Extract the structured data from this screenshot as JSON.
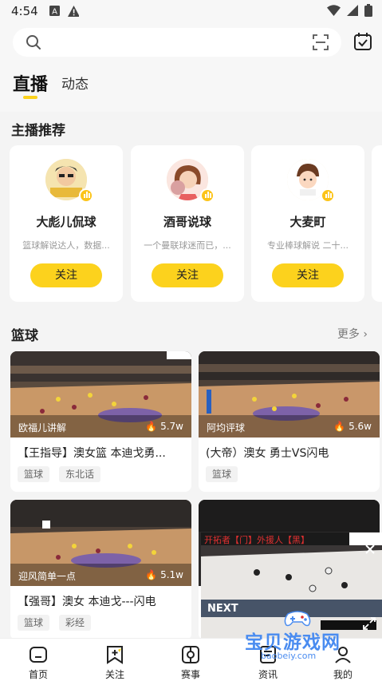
{
  "status": {
    "time": "4:54"
  },
  "search": {
    "placeholder": ""
  },
  "tabs": {
    "live": "直播",
    "feed": "动态"
  },
  "streamers_section": {
    "title": "主播推荐"
  },
  "streamers": [
    {
      "name": "大彪儿侃球",
      "desc": "篮球解说达人，数据...",
      "follow": "关注"
    },
    {
      "name": "酒哥说球",
      "desc": "一个曼联球迷而已，...",
      "follow": "关注"
    },
    {
      "name": "大麦町",
      "desc": "专业棒球解说 二十...",
      "follow": "关注"
    }
  ],
  "basketball": {
    "title": "篮球",
    "more": "更多"
  },
  "videos": [
    {
      "author": "欧福儿讲解",
      "views": "5.7w",
      "title": "【王指导】澳女篮 本迪戈勇...",
      "tags": [
        "篮球",
        "东北话"
      ]
    },
    {
      "author": "阿均评球",
      "views": "5.6w",
      "title": "(大帝）澳女 勇士VS闪电",
      "tags": [
        "篮球"
      ]
    },
    {
      "author": "迎风简单一点",
      "views": "5.1w",
      "title": "【强哥】澳女  本迪戈---闪电",
      "tags": [
        "篮球",
        "彩经"
      ]
    }
  ],
  "floating_player": {
    "caption": "开拓者【门】外援人【黑】"
  },
  "nav": {
    "home": "首页",
    "follow": "关注",
    "matches": "赛事",
    "news": "资讯",
    "mine": "我的"
  },
  "watermark": {
    "main": "宝贝游戏网",
    "sub": "baobeiy.com"
  },
  "colors": {
    "accent": "#fcd21d",
    "watermark": "#4a8cf0"
  }
}
